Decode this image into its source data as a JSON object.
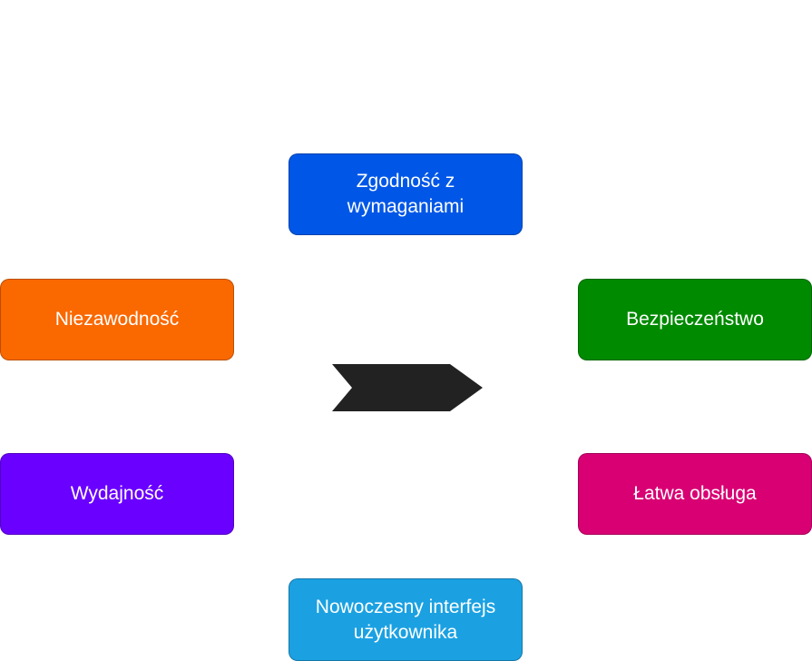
{
  "diagram": {
    "center_shape": "chevron-arrow",
    "center_color": "#222222",
    "nodes": [
      {
        "id": "top",
        "label": "Zgodność z wymaganiami",
        "color": "#0057e7"
      },
      {
        "id": "right",
        "label": "Bezpieczeństwo",
        "color": "#008a00"
      },
      {
        "id": "rbot",
        "label": "Łatwa obsługa",
        "color": "#d80073"
      },
      {
        "id": "bottom",
        "label": "Nowoczesny interfejs użytkownika",
        "color": "#1ba1e2"
      },
      {
        "id": "lbot",
        "label": "Wydajność",
        "color": "#6a00ff"
      },
      {
        "id": "left",
        "label": "Niezawodność",
        "color": "#fa6800"
      }
    ]
  }
}
